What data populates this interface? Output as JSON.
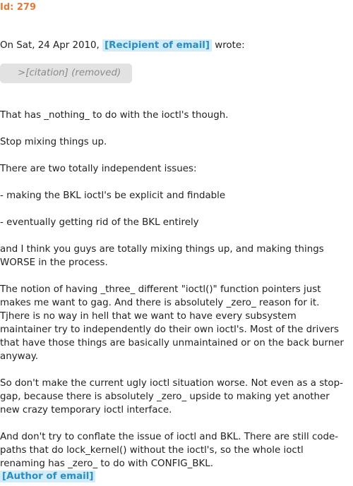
{
  "header": {
    "id_label": "Id: 279"
  },
  "intro": {
    "prefix": "On Sat, 24 Apr 2010, ",
    "recipient_tag": "[Recipient of email]",
    "suffix": " wrote:"
  },
  "citation": {
    "text": ">[citation] (removed)"
  },
  "body": {
    "paragraphs": [
      "That has _nothing_ to do with the ioctl's though.",
      "Stop mixing things up.",
      "There are two totally independent issues:",
      "- making the BKL ioctl's be explicit and findable",
      "- eventually getting rid of the BKL entirely",
      "and I think you guys are totally mixing things up, and making things WORSE in the process.",
      "The notion of having _three_ different \"ioctl()\" function pointers just makes me want to gag. And there is absolutely _zero_ reason for it. Tjhere is no way in hell that we want to have every subsystem maintainer try to independently do their own ioctl's. Most of the drivers that have those things are basically unmaintained or on the back burner anyway.",
      "So don't make the current ugly ioctl situation worse. Not even as a stop-gap, because there is absolutely _zero_ upside to making yet another new crazy temporary ioctl interface.",
      "And don't try to conflate the issue of ioctl and BKL. There are still code-paths that do lock_kernel() without the ioctl's, so the whole ioctl renaming has _zero_ to do with CONFIG_BKL."
    ]
  },
  "signature": {
    "author_tag": "[Author of email]"
  },
  "colors": {
    "id_label": "#e07b39",
    "tag_background": "#d2ecf9",
    "tag_text": "#2a8ec2",
    "citation_background": "#e2e2e2"
  }
}
